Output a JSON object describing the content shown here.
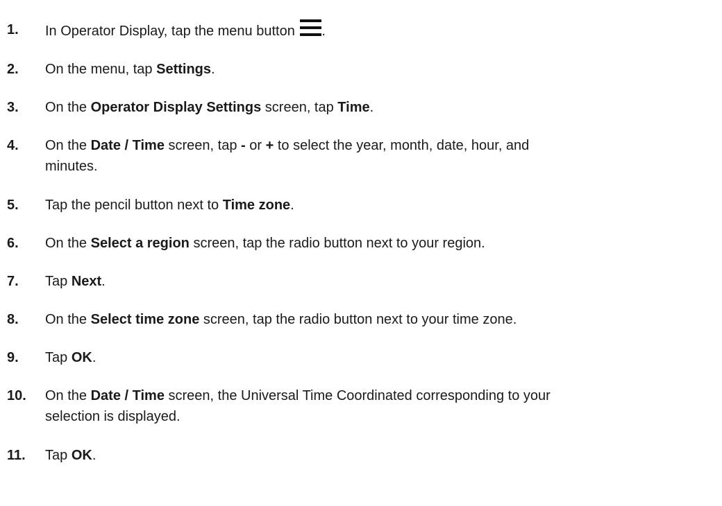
{
  "steps": [
    {
      "num": "1.",
      "parts": [
        "In Operator Display, tap the menu button ",
        "."
      ],
      "icon": "menu-icon"
    },
    {
      "num": "2.",
      "parts": [
        "On the menu, tap ",
        "Settings",
        "."
      ]
    },
    {
      "num": "3.",
      "parts": [
        "On the ",
        "Operator Display Settings",
        " screen, tap ",
        "Time",
        "."
      ]
    },
    {
      "num": "4.",
      "parts": [
        "On the ",
        "Date / Time",
        " screen, tap ",
        "-",
        " or ",
        "+",
        " to select the year, month, date, hour, and minutes."
      ]
    },
    {
      "num": "5.",
      "parts": [
        "Tap the pencil button next to ",
        "Time zone",
        "."
      ]
    },
    {
      "num": "6.",
      "parts": [
        "On the ",
        "Select a region",
        " screen, tap the radio button next to your region."
      ]
    },
    {
      "num": "7.",
      "parts": [
        "Tap ",
        "Next",
        "."
      ]
    },
    {
      "num": "8.",
      "parts": [
        "On the ",
        "Select time zone",
        " screen, tap the radio button next to your time zone."
      ]
    },
    {
      "num": "9.",
      "parts": [
        "Tap ",
        "OK",
        "."
      ]
    },
    {
      "num": "10.",
      "parts": [
        "On the ",
        "Date / Time",
        " screen, the Universal Time Coordinated corresponding to your selection is displayed."
      ]
    },
    {
      "num": "11.",
      "parts": [
        "Tap ",
        "OK",
        "."
      ]
    }
  ]
}
